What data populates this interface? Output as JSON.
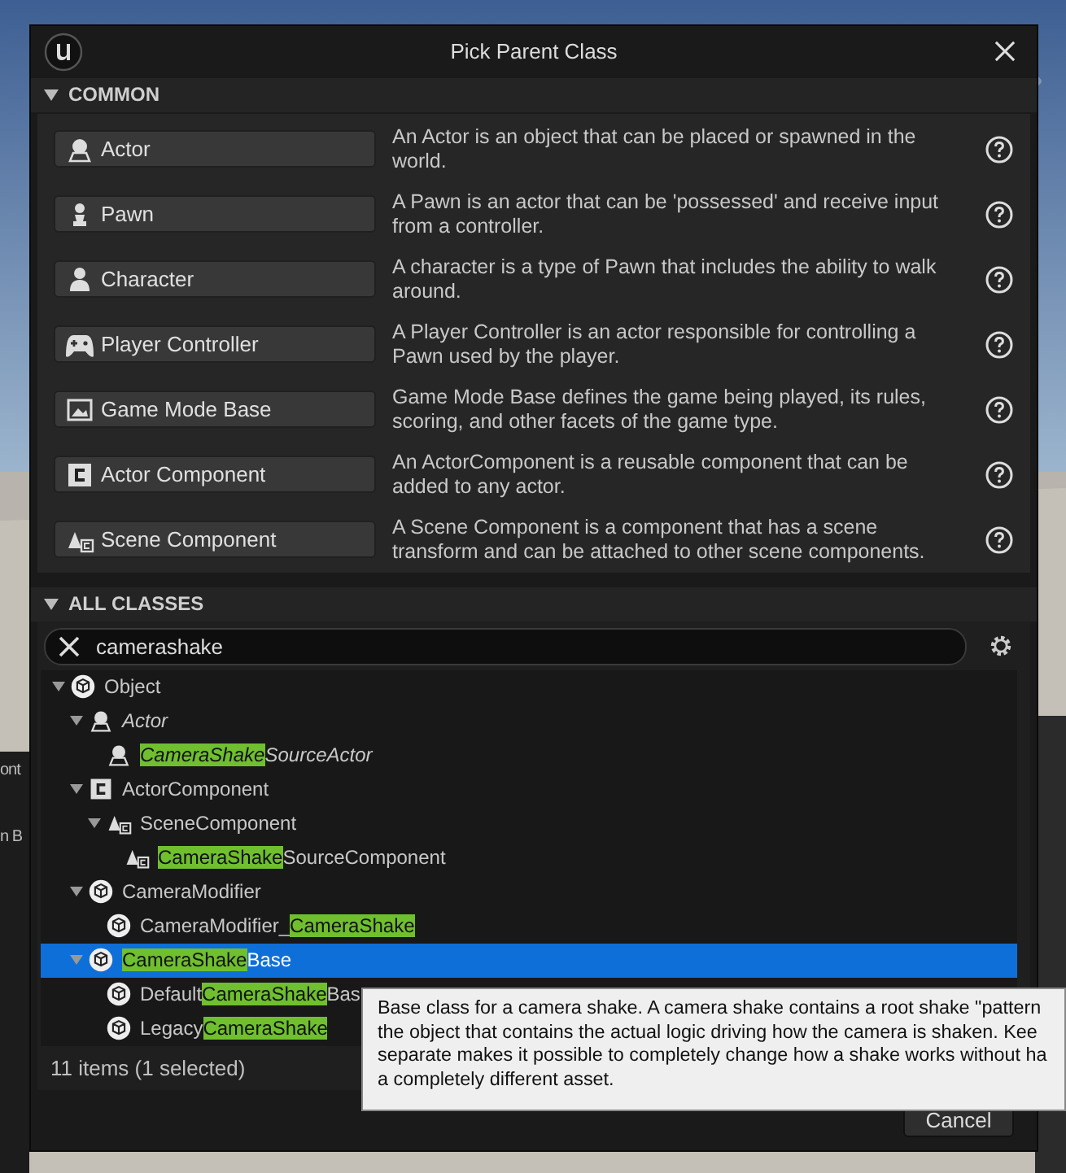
{
  "background": {
    "kind": "picture",
    "editor_fragments": [
      "ont",
      "n B"
    ]
  },
  "window": {
    "title": "Pick Parent Class"
  },
  "common": {
    "title": "COMMON",
    "expanded": true,
    "items": [
      {
        "kind": "actor",
        "label": "Actor",
        "description": "An Actor is an object that can be placed or spawned in the world."
      },
      {
        "kind": "pawn",
        "label": "Pawn",
        "description": "A Pawn is an actor that can be 'possessed' and receive input from a controller."
      },
      {
        "kind": "character",
        "label": "Character",
        "description": "A character is a type of Pawn that includes the ability to walk around."
      },
      {
        "kind": "controller",
        "label": "Player Controller",
        "description": "A Player Controller is an actor responsible for controlling a Pawn used by the player."
      },
      {
        "kind": "gamemode",
        "label": "Game Mode Base",
        "description": "Game Mode Base defines the game being played, its rules, scoring, and other facets of the game type."
      },
      {
        "kind": "component",
        "label": "Actor Component",
        "description": "An ActorComponent is a reusable component that can be added to any actor."
      },
      {
        "kind": "scene",
        "label": "Scene Component",
        "description": "A Scene Component is a component that has a scene transform and can be attached to other scene components."
      }
    ]
  },
  "all_classes": {
    "title": "ALL CLASSES",
    "expanded": true,
    "search": {
      "value": "camerashake"
    },
    "tree": [
      {
        "kind": "object",
        "italic": false,
        "selected": false,
        "expanded": true,
        "segments": [
          {
            "text": "Object",
            "match": false
          }
        ],
        "children": [
          {
            "kind": "actor",
            "italic": true,
            "selected": false,
            "expanded": true,
            "segments": [
              {
                "text": "Actor",
                "match": false
              }
            ],
            "children": [
              {
                "kind": "actor",
                "italic": true,
                "selected": false,
                "segments": [
                  {
                    "text": "CameraShake",
                    "match": true
                  },
                  {
                    "text": "SourceActor",
                    "match": false
                  }
                ]
              }
            ]
          },
          {
            "kind": "component",
            "italic": false,
            "selected": false,
            "expanded": true,
            "segments": [
              {
                "text": "ActorComponent",
                "match": false
              }
            ],
            "children": [
              {
                "kind": "scene",
                "italic": false,
                "selected": false,
                "expanded": true,
                "segments": [
                  {
                    "text": "SceneComponent",
                    "match": false
                  }
                ],
                "children": [
                  {
                    "kind": "scene",
                    "italic": false,
                    "selected": false,
                    "segments": [
                      {
                        "text": "CameraShake",
                        "match": true
                      },
                      {
                        "text": "SourceComponent",
                        "match": false
                      }
                    ]
                  }
                ]
              }
            ]
          },
          {
            "kind": "object",
            "italic": false,
            "selected": false,
            "expanded": true,
            "segments": [
              {
                "text": "CameraModifier",
                "match": false
              }
            ],
            "children": [
              {
                "kind": "object",
                "italic": false,
                "selected": false,
                "segments": [
                  {
                    "text": "CameraModifier_",
                    "match": false
                  },
                  {
                    "text": "CameraShake",
                    "match": true
                  }
                ]
              }
            ]
          },
          {
            "kind": "object",
            "italic": false,
            "selected": true,
            "expanded": true,
            "segments": [
              {
                "text": "CameraShake",
                "match": true
              },
              {
                "text": "Base",
                "match": false
              }
            ],
            "children": [
              {
                "kind": "object",
                "italic": false,
                "selected": false,
                "segments": [
                  {
                    "text": "Default",
                    "match": false
                  },
                  {
                    "text": "CameraShake",
                    "match": true
                  },
                  {
                    "text": "Bas",
                    "match": false
                  }
                ]
              },
              {
                "kind": "object",
                "italic": false,
                "selected": false,
                "segments": [
                  {
                    "text": "Legacy",
                    "match": false
                  },
                  {
                    "text": "CameraShake",
                    "match": true
                  }
                ]
              }
            ]
          }
        ]
      }
    ],
    "status": "11 items (1 selected)"
  },
  "tooltip": {
    "lines": [
      "Base class for a camera shake. A camera shake contains a root shake \"pattern",
      "the object that contains the actual logic driving how the camera is shaken. Kee",
      "separate makes it possible to completely change how a shake works without ha",
      "a completely different asset."
    ]
  },
  "buttons": [
    "Cancel"
  ]
}
